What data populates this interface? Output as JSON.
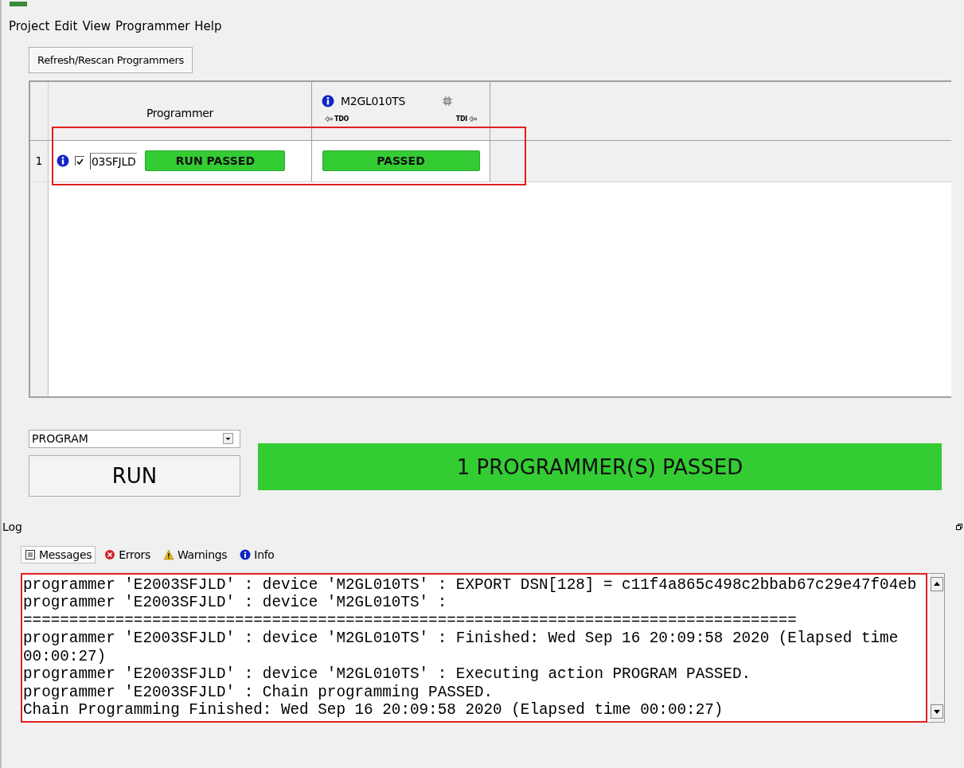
{
  "menu": [
    "Project",
    "Edit",
    "View",
    "Programmer",
    "Help"
  ],
  "refresh_button": "Refresh/Rescan Programmers",
  "table": {
    "programmer_column": "Programmer",
    "device_column": {
      "name": "M2GL010TS",
      "tdo": "TDO",
      "tdi": "TDI"
    },
    "rows": [
      {
        "index": "1",
        "checked": true,
        "programmer_id": "03SFJLD",
        "run_status": {
          "text": "RUN PASSED",
          "kind": "passed"
        },
        "device_status": {
          "text": "PASSED",
          "kind": "passed"
        },
        "highlighted": true
      }
    ]
  },
  "action": {
    "selected": "PROGRAM",
    "run_button": "RUN"
  },
  "banner": {
    "text": "1 PROGRAMMER(S) PASSED",
    "kind": "passed"
  },
  "log": {
    "title": "Log",
    "tabs": [
      {
        "label": "Messages",
        "kind": "messages",
        "selected": true
      },
      {
        "label": "Errors",
        "kind": "errors",
        "selected": false
      },
      {
        "label": "Warnings",
        "kind": "warnings",
        "selected": false
      },
      {
        "label": "Info",
        "kind": "info",
        "selected": false
      }
    ],
    "highlighted": true,
    "lines": [
      "programmer 'E2003SFJLD' : device 'M2GL010TS' : EXPORT DSN[128] = c11f4a865c498c2bbab67c29e47f04eb",
      "programmer 'E2003SFJLD' : device 'M2GL010TS' :",
      "====================================================================================",
      "programmer 'E2003SFJLD' : device 'M2GL010TS' : Finished: Wed Sep 16 20:09:58 2020 (Elapsed time 00:00:27)",
      "programmer 'E2003SFJLD' : device 'M2GL010TS' : Executing action PROGRAM PASSED.",
      "programmer 'E2003SFJLD' : Chain programming PASSED.",
      "Chain Programming Finished: Wed Sep 16 20:09:58 2020 (Elapsed time 00:00:27)"
    ]
  }
}
